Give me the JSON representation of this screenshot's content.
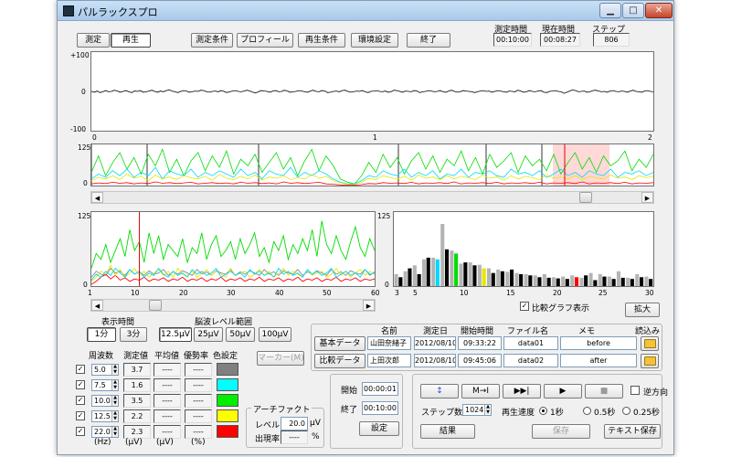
{
  "window": {
    "title": "パルラックスプロ",
    "minimize_glyph": "▁",
    "maximize_glyph": "□",
    "close_glyph": "✕"
  },
  "mode_buttons": {
    "measure": "測定",
    "playback": "再生"
  },
  "toolbar": {
    "measure_conditions": "測定条件",
    "profile": "プロフィール",
    "playback_conditions": "再生条件",
    "environment_settings": "環境設定",
    "exit": "終了"
  },
  "status": {
    "measure_time_label": "測定時間",
    "measure_time": "00:10:00",
    "current_time_label": "現在時間",
    "current_time": "00:08:27",
    "step_label": "ステップ",
    "step": "806"
  },
  "wave": {
    "y_top": "+100",
    "y_mid": "0",
    "y_bottom": "-100",
    "x_labels": [
      "0",
      "1",
      "2"
    ]
  },
  "overview": {
    "y_top": "125",
    "y_bottom": "0"
  },
  "trend": {
    "y_top": "125",
    "y_bottom": "0",
    "x_labels": [
      "1",
      "10",
      "20",
      "30",
      "40",
      "50",
      "60"
    ]
  },
  "spectrum": {
    "y_top": "125",
    "y_bottom": "0",
    "x_labels": [
      "3",
      "5",
      "10",
      "15",
      "20",
      "25",
      "30"
    ]
  },
  "chart_data": [
    {
      "type": "line",
      "name": "raw-eeg-wave",
      "x_range": [
        0,
        2
      ],
      "ylim": [
        -100,
        100
      ],
      "values": [
        0,
        -2,
        1,
        -3,
        -1,
        2,
        -1,
        0,
        3,
        1,
        -2,
        0,
        2,
        -1,
        -3,
        1,
        0,
        2,
        -2,
        -1,
        1,
        3,
        0,
        -2,
        1,
        -1,
        2,
        4,
        1,
        -1,
        -3,
        0,
        2,
        1,
        -2,
        -1,
        1,
        0,
        3,
        2,
        -1,
        -2,
        0,
        1,
        -1,
        2,
        0,
        -3,
        -1,
        1,
        2,
        0,
        -1,
        1,
        3,
        1,
        -2,
        -4,
        -1,
        2,
        1,
        0,
        -2,
        1,
        2,
        -1,
        0,
        3,
        1,
        -2,
        -1,
        0,
        2,
        1,
        -1,
        -2,
        1,
        3,
        0,
        -1,
        2,
        1,
        -3,
        -2,
        0,
        1,
        -1,
        2,
        3,
        0,
        -2,
        -1,
        1,
        0,
        2,
        -1,
        -3,
        0,
        1,
        2,
        0,
        -1,
        1,
        -2,
        -1,
        3,
        2,
        0,
        -2,
        1,
        0,
        -1,
        2,
        1,
        -3,
        -1,
        0,
        2,
        1,
        -1,
        0,
        2,
        -1,
        -2,
        1,
        3,
        0,
        -2,
        -1,
        2,
        1,
        0,
        -1,
        -3,
        -1,
        1,
        2,
        0,
        1,
        -2,
        0,
        2,
        1,
        -1,
        -2,
        1,
        0,
        -1,
        3,
        1,
        -2,
        -1,
        2,
        0,
        -1,
        1,
        2,
        -2,
        -3,
        0,
        1,
        2,
        0,
        -1,
        -5,
        -2,
        1,
        4,
        2,
        -1,
        0,
        1,
        -2,
        -1,
        2,
        3,
        1,
        -1,
        0,
        -2,
        1,
        2,
        0,
        -1,
        1,
        0,
        -2,
        1,
        3,
        0,
        -1,
        -2,
        1,
        2,
        0,
        -1
      ]
    },
    {
      "type": "line",
      "name": "overview-trend",
      "ylim": [
        0,
        125
      ],
      "series": [
        {
          "color": "#00dd00",
          "values": [
            40,
            90,
            30,
            70,
            100,
            50,
            85,
            35,
            95,
            60,
            110,
            40,
            80,
            30,
            75,
            100,
            45,
            90,
            55,
            105,
            35,
            80,
            60,
            95,
            40,
            70,
            100,
            50,
            85,
            30,
            75,
            110,
            45,
            90,
            60,
            20,
            10,
            5,
            30,
            70,
            40,
            95,
            55,
            85,
            35,
            75,
            100,
            50,
            90,
            40,
            80,
            60,
            105,
            45,
            85,
            35,
            95,
            55,
            75,
            100,
            40,
            90,
            60,
            80,
            45,
            95,
            35,
            70,
            100,
            50,
            85,
            40,
            90,
            60,
            75,
            105,
            45,
            80,
            55,
            95
          ]
        },
        {
          "color": "#00d8ff",
          "values": [
            20,
            35,
            25,
            45,
            30,
            50,
            25,
            40,
            30,
            55,
            20,
            45,
            35,
            30,
            50,
            25,
            40,
            30,
            45,
            35,
            25,
            50,
            30,
            40,
            20,
            45,
            35,
            30,
            55,
            25,
            40,
            30,
            45,
            35,
            20,
            10,
            5,
            5,
            15,
            30,
            25,
            45,
            35,
            30,
            50,
            25,
            40,
            30,
            45,
            20,
            35,
            30,
            50,
            25,
            40,
            35,
            45,
            30,
            25,
            50,
            35,
            40,
            30,
            45,
            25,
            35,
            50,
            30,
            40,
            25,
            45,
            35,
            30,
            50,
            25,
            40,
            35,
            45,
            30,
            40
          ]
        },
        {
          "color": "#e6e600",
          "values": [
            15,
            25,
            20,
            30,
            18,
            35,
            22,
            28,
            15,
            32,
            20,
            26,
            18,
            30,
            24,
            20,
            28,
            16,
            34,
            22,
            18,
            28,
            20,
            32,
            16,
            26,
            22,
            30,
            18,
            24,
            20,
            34,
            22,
            28,
            15,
            8,
            4,
            3,
            10,
            22,
            18,
            30,
            24,
            20,
            28,
            16,
            32,
            22,
            26,
            18,
            30,
            20,
            28,
            24,
            18,
            32,
            22,
            26,
            16,
            30,
            20,
            28,
            24,
            18,
            32,
            22,
            26,
            20,
            30,
            18,
            28,
            24,
            20,
            32,
            22,
            26,
            18,
            30,
            24,
            28
          ]
        },
        {
          "color": "#ff0000",
          "values": [
            5,
            8,
            6,
            10,
            7,
            9,
            5,
            8,
            6,
            11,
            7,
            9,
            6,
            8,
            10,
            5,
            7,
            9,
            6,
            8,
            5,
            10,
            7,
            9,
            6,
            8,
            5,
            11,
            7,
            9,
            6,
            8,
            10,
            5,
            4,
            2,
            1,
            1,
            3,
            6,
            5,
            9,
            7,
            8,
            6,
            10,
            5,
            8,
            7,
            9,
            6,
            11,
            5,
            8,
            7,
            9,
            6,
            10,
            5,
            8,
            7,
            9,
            6,
            10,
            5,
            8,
            7,
            9,
            6,
            11,
            5,
            8,
            7,
            9,
            6,
            10,
            5,
            8,
            7,
            9
          ]
        }
      ]
    },
    {
      "type": "line",
      "name": "band-trend",
      "x_range": [
        1,
        60
      ],
      "ylim": [
        0,
        125
      ],
      "series": [
        {
          "color": "#00dd00",
          "values": [
            30,
            55,
            45,
            70,
            40,
            60,
            80,
            50,
            95,
            60,
            75,
            40,
            90,
            55,
            85,
            45,
            70,
            60,
            50,
            80,
            40,
            65,
            55,
            90,
            45,
            70,
            85,
            50,
            60,
            75,
            45,
            80,
            55,
            70,
            90,
            50,
            65,
            40,
            75,
            60,
            85,
            45,
            70,
            55,
            80,
            60,
            95,
            50,
            110,
            70,
            55,
            85,
            60,
            45,
            75,
            100,
            65,
            50,
            80,
            60
          ]
        },
        {
          "color": "#00d8ff",
          "values": [
            10,
            20,
            15,
            25,
            18,
            30,
            22,
            15,
            28,
            20,
            25,
            15,
            22,
            18,
            30,
            20,
            15,
            25,
            18,
            22,
            15,
            28,
            20,
            25,
            18,
            22,
            30,
            15,
            20,
            25,
            18,
            22,
            15,
            28,
            20,
            25,
            18,
            22,
            15,
            30,
            20,
            25,
            18,
            22,
            15,
            28,
            20,
            25,
            18,
            22,
            30,
            15,
            20,
            25,
            18,
            22,
            15,
            28,
            20,
            22
          ]
        },
        {
          "color": "#e6e600",
          "values": [
            8,
            15,
            25,
            20,
            35,
            18,
            28,
            15,
            22,
            30,
            18,
            25,
            15,
            22,
            28,
            18,
            25,
            15,
            30,
            20,
            18,
            25,
            15,
            22,
            28,
            18,
            25,
            20,
            15,
            30,
            18,
            22,
            25,
            15,
            20,
            28,
            18,
            25,
            15,
            22,
            30,
            18,
            25,
            20,
            15,
            28,
            18,
            22,
            25,
            15,
            20,
            30,
            18,
            25,
            15,
            22,
            28,
            18,
            25,
            20
          ]
        },
        {
          "color": "#ff0000",
          "values": [
            3,
            8,
            15,
            20,
            12,
            18,
            10,
            14,
            8,
            12,
            10,
            15,
            8,
            12,
            10,
            14,
            8,
            12,
            10,
            15,
            8,
            12,
            10,
            14,
            8,
            12,
            10,
            15,
            8,
            12,
            10,
            14,
            8,
            12,
            10,
            15,
            8,
            12,
            10,
            14,
            8,
            12,
            10,
            15,
            8,
            12,
            10,
            14,
            8,
            12,
            10,
            15,
            8,
            12,
            10,
            14,
            8,
            12,
            10,
            12
          ]
        },
        {
          "color": "#888888",
          "values": [
            15,
            25,
            20,
            18,
            30,
            22,
            25,
            18,
            28,
            20,
            24,
            18,
            26,
            20,
            22,
            28,
            18,
            24,
            20,
            26,
            22,
            18,
            28,
            20,
            24,
            18,
            26,
            22,
            20,
            28,
            18,
            24,
            20,
            26,
            22,
            18,
            28,
            20,
            24,
            18,
            26,
            22,
            20,
            28,
            18,
            24,
            20,
            26,
            22,
            18,
            28,
            20,
            24,
            18,
            26,
            22,
            20,
            28,
            18,
            24
          ]
        }
      ]
    },
    {
      "type": "bar",
      "name": "frequency-spectrum",
      "x_range": [
        3,
        30
      ],
      "ylim": [
        0,
        125
      ],
      "categories": [
        3,
        4,
        5,
        6,
        7,
        8,
        9,
        10,
        11,
        12,
        13,
        14,
        15,
        16,
        17,
        18,
        19,
        20,
        21,
        22,
        23,
        24,
        25,
        26,
        27,
        28,
        29,
        30
      ],
      "values": [
        15,
        30,
        20,
        48,
        45,
        62,
        55,
        40,
        35,
        30,
        22,
        25,
        28,
        20,
        18,
        15,
        14,
        13,
        12,
        15,
        18,
        10,
        16,
        12,
        14,
        12,
        15,
        12
      ],
      "compare_values": [
        20,
        25,
        35,
        45,
        48,
        105,
        60,
        38,
        40,
        36,
        30,
        28,
        24,
        22,
        20,
        18,
        20,
        15,
        16,
        18,
        14,
        22,
        20,
        16,
        25,
        14,
        20,
        16
      ],
      "highlight": {
        "7": "#00d8ff",
        "9": "#00dd00",
        "12": "#e6e600",
        "22": "#ff0000"
      }
    }
  ],
  "display_time": {
    "label": "表示時間",
    "opt1": "1分",
    "opt2": "3分"
  },
  "eeg_range": {
    "label": "脳波レベル範囲",
    "opts": [
      "12.5μV",
      "25μV",
      "50μV",
      "100μV"
    ]
  },
  "bands": {
    "headers": {
      "freq": "周波数",
      "value": "測定値",
      "avg": "平均値",
      "dominance": "優勢率",
      "color": "色設定"
    },
    "rows": [
      {
        "freq": "5.0",
        "value": "3.7",
        "avg": "----",
        "dominance": "----",
        "color": "#808080"
      },
      {
        "freq": "7.5",
        "value": "1.6",
        "avg": "----",
        "dominance": "----",
        "color": "#00ffff"
      },
      {
        "freq": "10.0",
        "value": "3.5",
        "avg": "----",
        "dominance": "----",
        "color": "#00ee00"
      },
      {
        "freq": "12.5",
        "value": "2.2",
        "avg": "----",
        "dominance": "----",
        "color": "#ffff00"
      },
      {
        "freq": "22.0",
        "value": "2.3",
        "avg": "----",
        "dominance": "----",
        "color": "#ff0000"
      }
    ],
    "units": {
      "freq": "(Hz)",
      "value": "(μV)",
      "avg": "(μV)",
      "dominance": "(%)"
    }
  },
  "marker_button": "マーカー(M)",
  "artifact": {
    "title": "アーチファクト",
    "level_label": "レベル",
    "level_value": "20.0",
    "level_unit": "μV",
    "rate_label": "出現率",
    "rate_value": "----",
    "rate_unit": "%"
  },
  "data_table": {
    "headers": {
      "name": "名前",
      "date": "測定日",
      "start": "開始時間",
      "file": "ファイル名",
      "memo": "メモ",
      "load": "読込み"
    },
    "rows": [
      {
        "label": "基本データ",
        "name": "山田奈緒子",
        "date": "2012/08/10",
        "start": "09:33:22",
        "file": "data01",
        "memo": "before"
      },
      {
        "label": "比較データ",
        "name": "上田次郎",
        "date": "2012/08/10",
        "start": "09:45:06",
        "file": "data02",
        "memo": "after"
      }
    ]
  },
  "range": {
    "start_label": "開始",
    "start": "00:00:01",
    "end_label": "終了",
    "end": "00:10:00",
    "set": "設定"
  },
  "player": {
    "fast_reverse": "↕",
    "step_forward": "M→I",
    "skip_end": "▶▶|",
    "play": "▶",
    "stop": "■",
    "reverse_label": "逆方向",
    "step_label": "ステップ数",
    "step_value": "1024",
    "speed_label": "再生速度",
    "speed_opts": [
      "1秒",
      "0.5秒",
      "0.25秒"
    ],
    "result": "結果",
    "save": "保存",
    "text_save": "テキスト保存"
  },
  "compare_graph": "比較グラフ表示",
  "expand": "拡大",
  "check_glyph": "✓",
  "spin_glyph_up": "▲",
  "spin_glyph_down": "▼",
  "scroll_left": "◀",
  "scroll_right": "▶"
}
